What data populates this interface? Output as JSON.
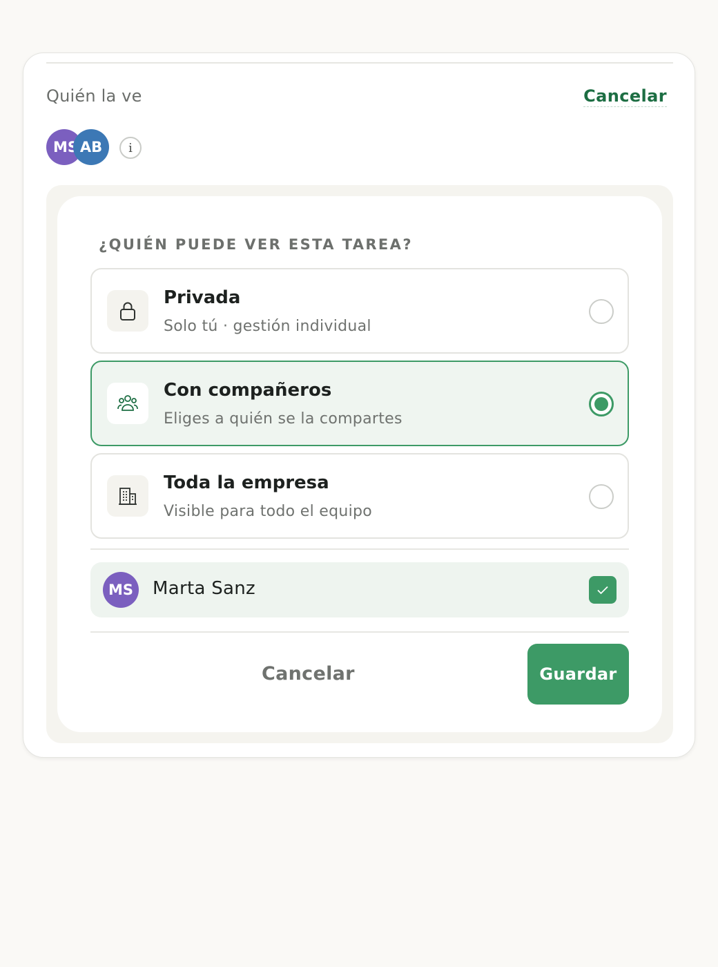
{
  "header": {
    "label": "Quién la ve",
    "cancel_label": "Cancelar"
  },
  "avatars": [
    {
      "initials": "MS",
      "color": "#7b5fbf"
    },
    {
      "initials": "AB",
      "color": "#3c78b5"
    }
  ],
  "info_icon_glyph": "i",
  "panel": {
    "title": "¿QUIÉN PUEDE VER ESTA TAREA?",
    "options": [
      {
        "title": "Privada",
        "subtitle": "Solo tú · gestión individual",
        "icon": "lock-icon",
        "selected": false
      },
      {
        "title": "Con compañeros",
        "subtitle": "Eliges a quién se la compartes",
        "icon": "people-icon",
        "selected": true
      },
      {
        "title": "Toda la empresa",
        "subtitle": "Visible para todo el equipo",
        "icon": "building-icon",
        "selected": false
      }
    ],
    "members": [
      {
        "initials": "MS",
        "name": "Marta Sanz",
        "checked": true
      }
    ],
    "cancel_label": "Cancelar",
    "save_label": "Guardar"
  },
  "colors": {
    "accent": "#3d9a66",
    "accent_dark": "#1d6e43",
    "selected_bg": "#eff5f0"
  }
}
